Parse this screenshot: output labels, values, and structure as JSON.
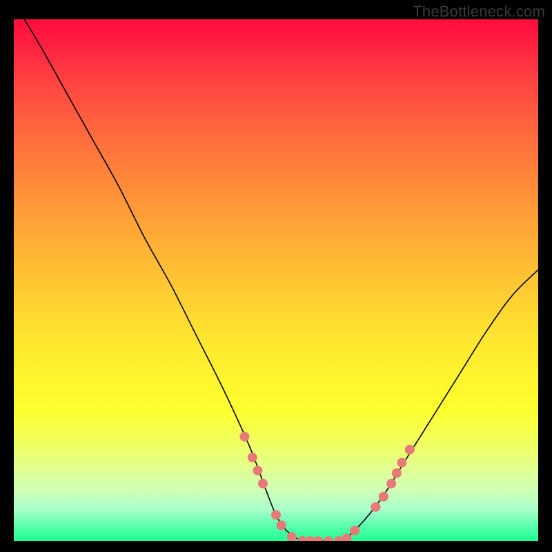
{
  "watermark": "TheBottleneck.com",
  "chart_data": {
    "type": "line",
    "title": "",
    "xlabel": "",
    "ylabel": "",
    "xlim": [
      0,
      100
    ],
    "ylim": [
      0,
      100
    ],
    "grid": false,
    "series": [
      {
        "name": "bottleneck_curve",
        "x": [
          2,
          5,
          10,
          15,
          20,
          25,
          30,
          35,
          40,
          45,
          48,
          50,
          52,
          55,
          58,
          60,
          62,
          65,
          70,
          75,
          80,
          85,
          90,
          95,
          100
        ],
        "y": [
          100,
          95,
          86,
          77,
          68,
          58,
          49,
          39,
          29,
          18,
          10,
          5,
          2,
          0,
          0,
          0,
          0,
          2,
          8,
          16,
          24,
          32,
          40,
          47,
          52
        ]
      }
    ],
    "markers": {
      "color": "#e77a77",
      "radius_css_px": 7,
      "points": [
        {
          "x": 44,
          "y": 20
        },
        {
          "x": 45.5,
          "y": 16
        },
        {
          "x": 46.5,
          "y": 13.5
        },
        {
          "x": 47.5,
          "y": 11
        },
        {
          "x": 50,
          "y": 5
        },
        {
          "x": 51,
          "y": 3
        },
        {
          "x": 53,
          "y": 0.8
        },
        {
          "x": 55,
          "y": 0
        },
        {
          "x": 56.5,
          "y": 0
        },
        {
          "x": 58,
          "y": 0
        },
        {
          "x": 60,
          "y": 0
        },
        {
          "x": 62,
          "y": 0
        },
        {
          "x": 63.5,
          "y": 0.5
        },
        {
          "x": 65,
          "y": 2
        },
        {
          "x": 69,
          "y": 6.5
        },
        {
          "x": 70.5,
          "y": 8.5
        },
        {
          "x": 72,
          "y": 11
        },
        {
          "x": 73,
          "y": 13
        },
        {
          "x": 74,
          "y": 15
        },
        {
          "x": 75.5,
          "y": 17.5
        }
      ]
    },
    "background_gradient_stops": [
      {
        "pos": 0.0,
        "color": "#ff0d3e"
      },
      {
        "pos": 0.35,
        "color": "#ff9638"
      },
      {
        "pos": 0.7,
        "color": "#fff72e"
      },
      {
        "pos": 0.94,
        "color": "#a8ffca"
      },
      {
        "pos": 1.0,
        "color": "#1eff92"
      }
    ]
  }
}
